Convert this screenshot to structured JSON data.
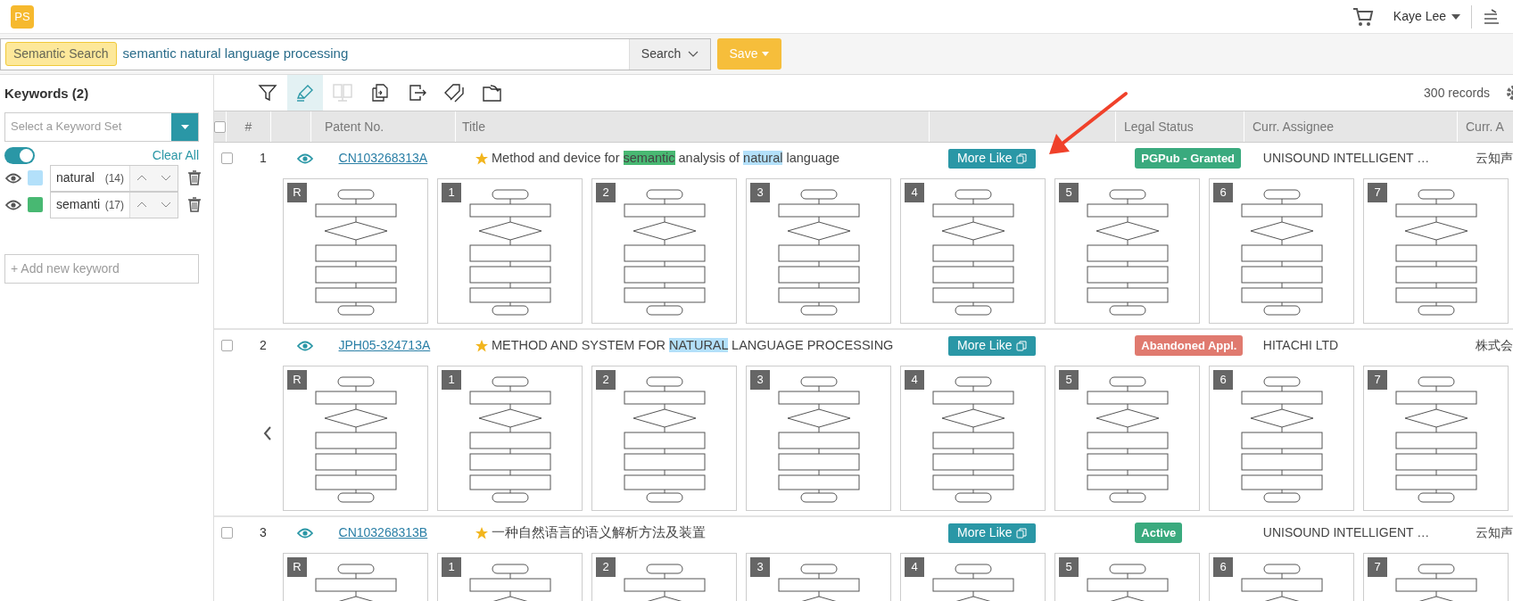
{
  "header": {
    "logo": "PS",
    "user": "Kaye Lee"
  },
  "search": {
    "tag": "Semantic Search",
    "query": "semantic natural language processing",
    "search_button": "Search",
    "save_button": "Save"
  },
  "sidebar": {
    "title": "Keywords (2)",
    "keyword_set": {
      "placeholder": "Select a Keyword Set"
    },
    "toggle": {
      "on": true
    },
    "clear_all": "Clear All",
    "keywords": [
      {
        "text": "natural",
        "count": "(14)",
        "color": "#b3e0fa"
      },
      {
        "text": "semanti",
        "count": "(17)",
        "color": "#48b872"
      }
    ],
    "add_keyword": {
      "placeholder": "+ Add new keyword"
    }
  },
  "toolbar": {
    "tools": [
      {
        "kind": "filter",
        "selected": false,
        "disabled": false
      },
      {
        "kind": "highlight",
        "selected": true,
        "disabled": false
      },
      {
        "kind": "compare",
        "selected": false,
        "disabled": true
      },
      {
        "kind": "transfer",
        "selected": false,
        "disabled": false
      },
      {
        "kind": "export",
        "selected": false,
        "disabled": false
      },
      {
        "kind": "tag",
        "selected": false,
        "disabled": false
      },
      {
        "kind": "folder",
        "selected": false,
        "disabled": false
      }
    ],
    "records": "300 records"
  },
  "table": {
    "select_all_checked": false,
    "columns": [
      "#",
      "Patent No.",
      "Title",
      "Legal Status",
      "Curr. Assignee",
      "Curr. A"
    ],
    "rows": [
      {
        "checked": false,
        "number": "1",
        "patent_no": "CN103268313A",
        "starred": true,
        "title": [
          {
            "text": "Method and device for "
          },
          {
            "text": "semantic",
            "color": "#48b872"
          },
          {
            "text": " analysis of "
          },
          {
            "text": "natural",
            "color": "#b3e0fa"
          },
          {
            "text": " language"
          }
        ],
        "more_like": "More Like",
        "legal_status": {
          "label": "PGPub - Granted",
          "color": "#3aaa7e"
        },
        "assignee": "UNISOUND INTELLIGENT …",
        "column_8": "云知声",
        "has_prev": false,
        "thumbnails": [
          "R",
          "1",
          "2",
          "3",
          "4",
          "5",
          "6",
          "7"
        ]
      },
      {
        "checked": false,
        "number": "2",
        "patent_no": "JPH05-324713A",
        "starred": true,
        "title": [
          {
            "text": "METHOD AND SYSTEM FOR "
          },
          {
            "text": "NATURAL",
            "color": "#b3e0fa"
          },
          {
            "text": " LANGUAGE PROCESSING"
          }
        ],
        "more_like": "More Like",
        "legal_status": {
          "label": "Abandoned Appl.",
          "color": "#e07a6f"
        },
        "assignee": "HITACHI LTD",
        "column_8": "株式会",
        "has_prev": true,
        "thumbnails": [
          "R",
          "1",
          "2",
          "3",
          "4",
          "5",
          "6",
          "7"
        ]
      },
      {
        "checked": false,
        "number": "3",
        "patent_no": "CN103268313B",
        "starred": true,
        "title": [
          {
            "text": "一种自然语言的语义解析方法及装置"
          }
        ],
        "more_like": "More Like",
        "legal_status": {
          "label": "Active",
          "color": "#3aaa7e"
        },
        "assignee": "UNISOUND INTELLIGENT …",
        "column_8": "云知声",
        "has_prev": false,
        "thumbnails": [
          "R",
          "1",
          "2",
          "3",
          "4",
          "5",
          "6",
          "7"
        ]
      }
    ]
  }
}
